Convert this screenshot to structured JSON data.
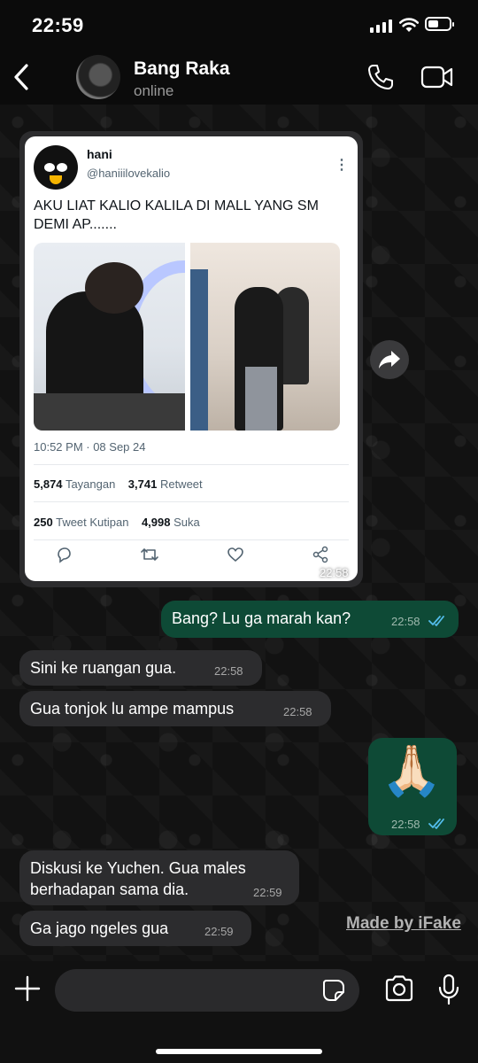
{
  "status_bar": {
    "time": "22:59"
  },
  "header": {
    "contact_name": "Bang Raka",
    "contact_status": "online"
  },
  "tweet": {
    "name": "hani",
    "handle": "@haniiilovekalio",
    "text": "AKU LIAT KALIO KALILA DI MALL YANG SM DEMI AP.......",
    "timestamp": "10:52 PM · 08 Sep 24",
    "views_count": "5,874",
    "views_label": "Tayangan",
    "retweets_count": "3,741",
    "retweets_label": "Retweet",
    "quotes_count": "250",
    "quotes_label": "Tweet Kutipan",
    "likes_count": "4,998",
    "likes_label": "Suka",
    "message_time": "22:58"
  },
  "messages": [
    {
      "direction": "out",
      "text": "Bang? Lu ga marah kan?",
      "time": "22:58"
    },
    {
      "direction": "in",
      "text": "Sini ke ruangan gua.",
      "time": "22:58"
    },
    {
      "direction": "in",
      "text": "Gua tonjok lu ampe mampus",
      "time": "22:58"
    },
    {
      "direction": "out",
      "text": "🙏🏻",
      "time": "22:58"
    },
    {
      "direction": "in",
      "text_line1": "Diskusi ke Yuchen. Gua males",
      "text_line2": "berhadapan sama dia.",
      "time": "22:59"
    },
    {
      "direction": "in",
      "text": "Ga jago ngeles gua",
      "time": "22:59"
    }
  ],
  "watermark": "Made by iFake",
  "composer": {
    "value": ""
  },
  "colors": {
    "outgoing_bubble": "#0e4a36",
    "incoming_bubble": "#2c2c2e",
    "read_ticks": "#53bdeb"
  }
}
